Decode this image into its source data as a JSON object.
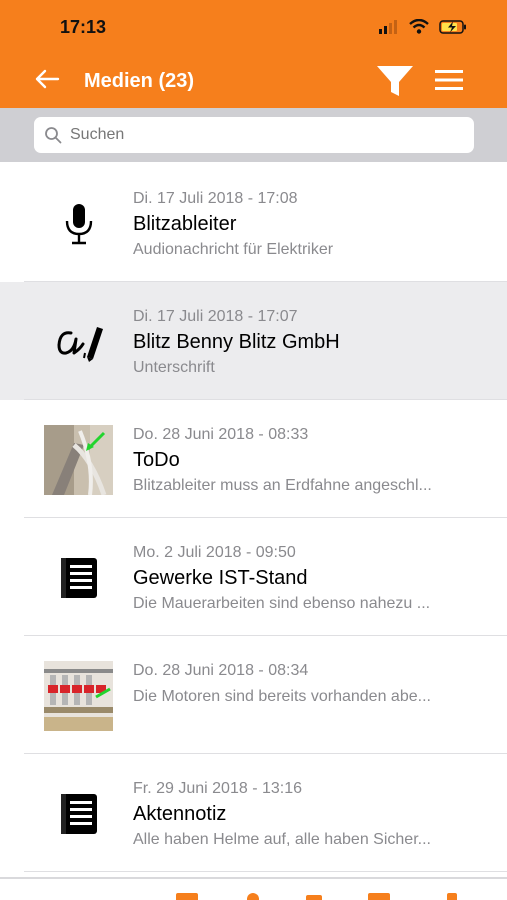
{
  "status_bar": {
    "time": "17:13",
    "icons": [
      "signal-icon",
      "wifi-icon",
      "battery-charging-icon"
    ]
  },
  "nav": {
    "back_icon": "arrow-left-icon",
    "title": "Medien (23)",
    "filter_icon": "filter-icon",
    "menu_icon": "hamburger-menu-icon"
  },
  "search": {
    "value": "",
    "placeholder": "Suchen"
  },
  "colors": {
    "accent": "#f67f1c",
    "highlight_row": "#ececee",
    "secondary_text": "#8a8a8e"
  },
  "items": [
    {
      "date": "Di. 17 Juli 2018 - 17:08",
      "title": "Blitzableiter",
      "subtitle": "Audionachricht für Elektriker",
      "icon": "microphone-icon"
    },
    {
      "date": "Di. 17 Juli 2018 - 17:07",
      "title": "Blitz Benny Blitz GmbH",
      "subtitle": "Unterschrift",
      "icon": "signature-icon"
    },
    {
      "date": "Do. 28 Juni 2018 - 08:33",
      "title": "ToDo",
      "subtitle": "Blitzableiter muss an Erdfahne angeschl...",
      "icon": "photo-thumbnail"
    },
    {
      "date": "Mo. 2 Juli 2018 - 09:50",
      "title": "Gewerke IST-Stand",
      "subtitle": "Die Mauerarbeiten sind ebenso nahezu ...",
      "icon": "document-icon"
    },
    {
      "date": "Do. 28 Juni 2018 - 08:34",
      "title": "",
      "subtitle": "Die Motoren sind bereits vorhanden abe...",
      "icon": "photo-thumbnail"
    },
    {
      "date": "Fr. 29 Juni 2018 - 13:16",
      "title": "Aktennotiz",
      "subtitle": "Alle haben Helme auf, alle haben Sicher...",
      "icon": "document-icon"
    }
  ]
}
